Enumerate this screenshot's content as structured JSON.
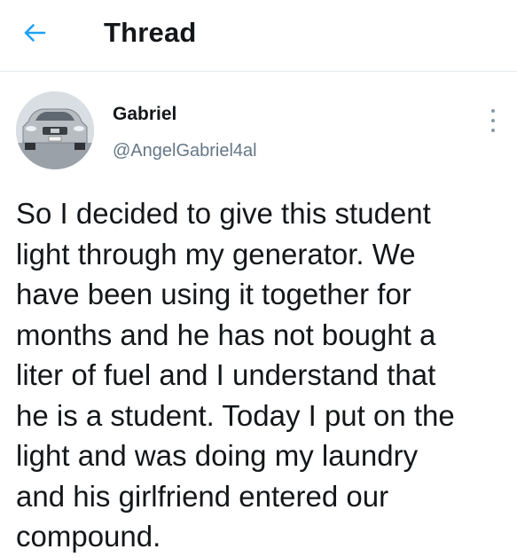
{
  "header": {
    "title": "Thread",
    "back_icon": "arrow-left-icon",
    "accent_color": "#1da1f2"
  },
  "tweet": {
    "author": {
      "display_name": "Gabriel",
      "handle": "@AngelGabriel4al",
      "avatar": "car-photo-avatar"
    },
    "more_icon": "vertical-dots-icon",
    "text": "So I decided to give this student\nlight through my generator. We\nhave been using it together for\nmonths and he has not bought a\nliter of fuel and I understand that\nhe is a student. Today I put on the\nlight and was doing my laundry\nand his girlfriend entered our\ncompound."
  }
}
